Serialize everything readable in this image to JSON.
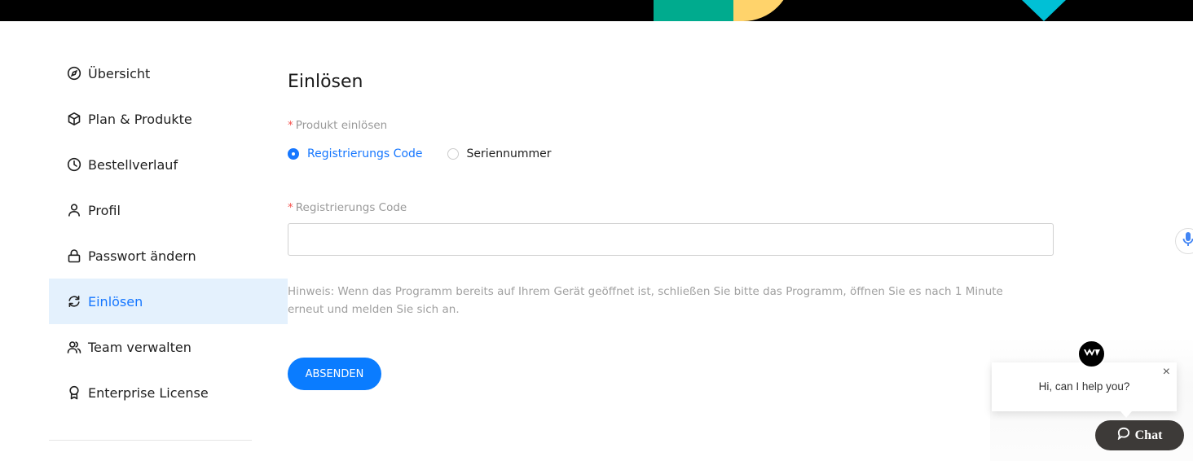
{
  "sidebar": {
    "items": [
      {
        "label": "Übersicht",
        "icon": "compass-icon",
        "active": false
      },
      {
        "label": "Plan & Produkte",
        "icon": "box-icon",
        "active": false
      },
      {
        "label": "Bestellverlauf",
        "icon": "clock-icon",
        "active": false
      },
      {
        "label": "Profil",
        "icon": "user-icon",
        "active": false
      },
      {
        "label": "Passwort ändern",
        "icon": "lock-icon",
        "active": false
      },
      {
        "label": "Einlösen",
        "icon": "refresh-icon",
        "active": true
      },
      {
        "label": "Team verwalten",
        "icon": "users-icon",
        "active": false
      },
      {
        "label": "Enterprise License",
        "icon": "award-icon",
        "active": false
      }
    ]
  },
  "main": {
    "title": "Einlösen",
    "redeem_label": "Produkt einlösen",
    "required_marker": "*",
    "options": [
      {
        "label": "Registrierungs Code",
        "checked": true
      },
      {
        "label": "Seriennummer",
        "checked": false
      }
    ],
    "code_label": "Registrierungs Code",
    "code_value": "",
    "code_placeholder": "",
    "hint": "Hinweis: Wenn das Programm bereits auf Ihrem Gerät geöffnet ist, schließen Sie bitte das Programm, öffnen Sie es nach 1 Minute erneut und melden Sie sich an.",
    "submit_label": "ABSENDEN"
  },
  "chat": {
    "greeting": "Hi, can I help you?",
    "close_label": "×",
    "button_label": "Chat"
  },
  "colors": {
    "accent": "#1677ff",
    "button": "#0a7cff",
    "active_bg": "#e4f1fd",
    "required": "#f5534f",
    "chat_button": "#3d3a38"
  }
}
